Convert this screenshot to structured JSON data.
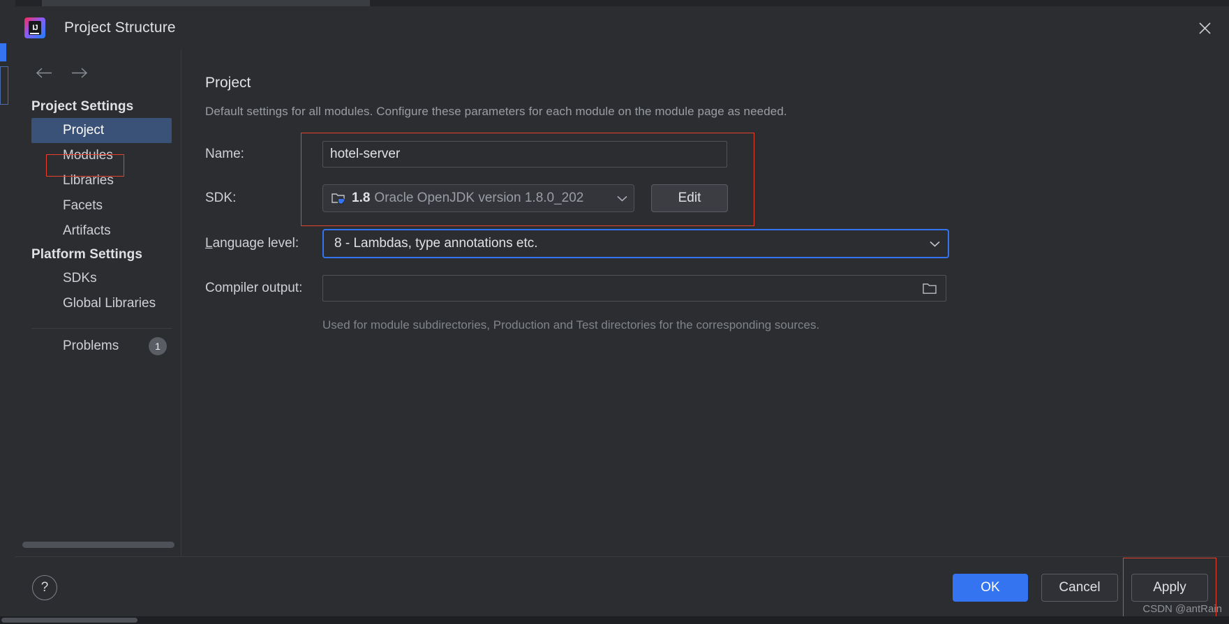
{
  "window": {
    "title": "Project Structure",
    "logo_text": "IJ",
    "close_icon": "close-icon"
  },
  "sidebar": {
    "back_icon": "arrow-left-icon",
    "forward_icon": "arrow-right-icon",
    "groups": [
      {
        "header": "Project Settings",
        "items": [
          {
            "label": "Project",
            "selected": true
          },
          {
            "label": "Modules",
            "selected": false
          },
          {
            "label": "Libraries",
            "selected": false
          },
          {
            "label": "Facets",
            "selected": false
          },
          {
            "label": "Artifacts",
            "selected": false
          }
        ]
      },
      {
        "header": "Platform Settings",
        "items": [
          {
            "label": "SDKs",
            "selected": false
          },
          {
            "label": "Global Libraries",
            "selected": false
          }
        ]
      }
    ],
    "problems": {
      "label": "Problems",
      "count": "1"
    }
  },
  "main": {
    "title": "Project",
    "description": "Default settings for all modules. Configure these parameters for each module on the module page as needed.",
    "fields": {
      "name": {
        "label": "Name:",
        "value": "hotel-server",
        "placeholder": ""
      },
      "sdk": {
        "label": "SDK:",
        "version": "1.8",
        "description": "Oracle OpenJDK version 1.8.0_202",
        "icon": "jdk-folder-icon",
        "arrow_icon": "chevron-down-icon",
        "edit_button": "Edit"
      },
      "language_level": {
        "label_mnemonic": "L",
        "label_rest": "anguage level:",
        "value": "8 - Lambdas, type annotations etc.",
        "arrow_icon": "chevron-down-icon"
      },
      "compiler_output": {
        "label": "Compiler output:",
        "value": "",
        "placeholder": "",
        "browse_icon": "folder-icon",
        "hint": "Used for module subdirectories, Production and Test directories for the corresponding sources."
      }
    }
  },
  "footer": {
    "help_label": "?",
    "ok_label": "OK",
    "cancel_label": "Cancel",
    "apply_label": "Apply"
  },
  "watermark": "CSDN @antRain",
  "colors": {
    "accent": "#3574f0",
    "selection": "#3b5278",
    "annotation": "#e8402a",
    "background": "#2b2d30",
    "text": "#dfe1e5",
    "muted": "#9a9da3"
  }
}
